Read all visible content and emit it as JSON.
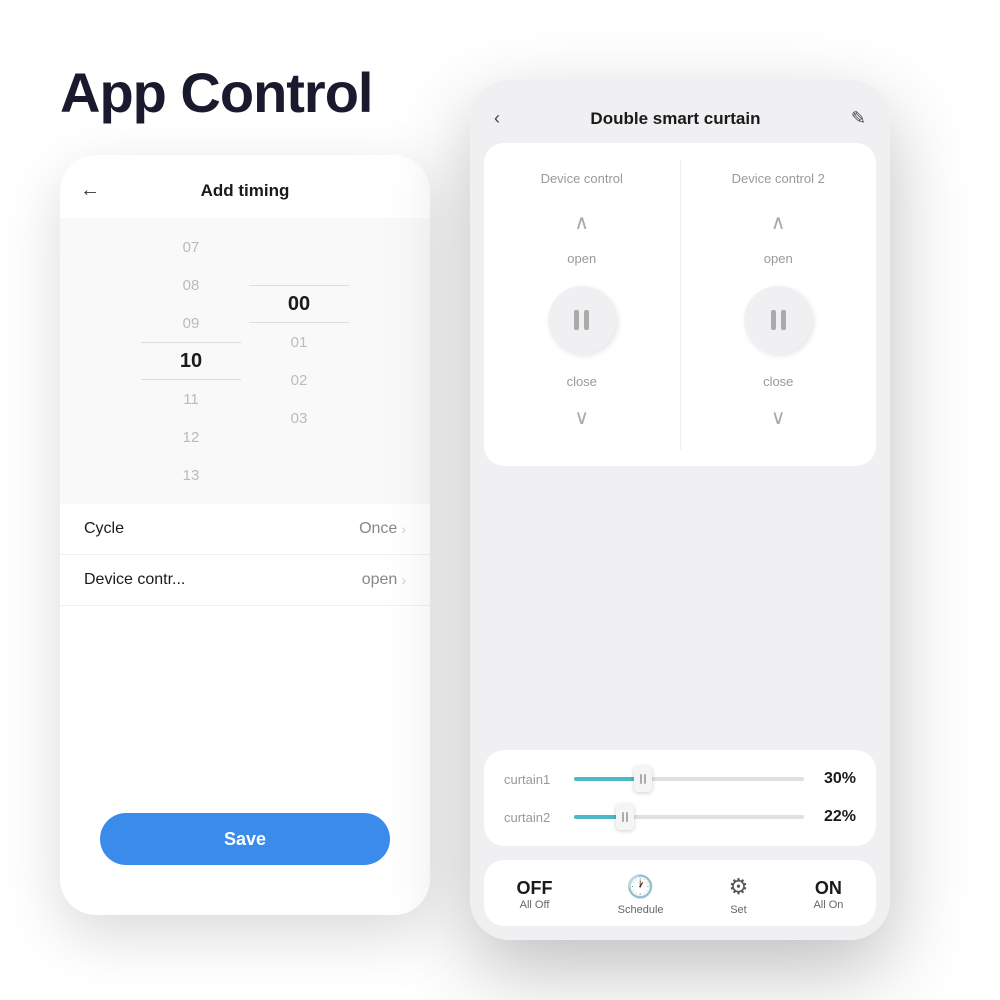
{
  "title": "App Control",
  "left_phone": {
    "header": "Add timing",
    "back": "←",
    "time_picker": {
      "hours": [
        "07",
        "08",
        "09",
        "10",
        "11",
        "12",
        "13"
      ],
      "minutes": [
        "00",
        "01",
        "02",
        "03"
      ],
      "selected_hour": "10",
      "selected_minute": "00"
    },
    "settings": [
      {
        "label": "Cycle",
        "value": "Once"
      },
      {
        "label": "Device contr...",
        "value": "open"
      }
    ],
    "save_btn": "Save"
  },
  "right_phone": {
    "header": "Double smart curtain",
    "back": "‹",
    "edit": "✎",
    "device_controls": [
      {
        "label": "Device control",
        "open": "open",
        "close": "close"
      },
      {
        "label": "Device control 2",
        "open": "open",
        "close": "close"
      }
    ],
    "sliders": [
      {
        "label": "curtain1",
        "percent": 30,
        "fill_pct": "30%"
      },
      {
        "label": "curtain2",
        "percent": 22,
        "fill_pct": "22%"
      }
    ],
    "bottom_bar": [
      {
        "icon": "OFF",
        "type": "text",
        "label": "All Off"
      },
      {
        "icon": "🕐",
        "type": "emoji",
        "label": "Schedule"
      },
      {
        "icon": "⚙",
        "type": "emoji",
        "label": "Set"
      },
      {
        "icon": "ON",
        "type": "text",
        "label": "All On"
      }
    ]
  }
}
